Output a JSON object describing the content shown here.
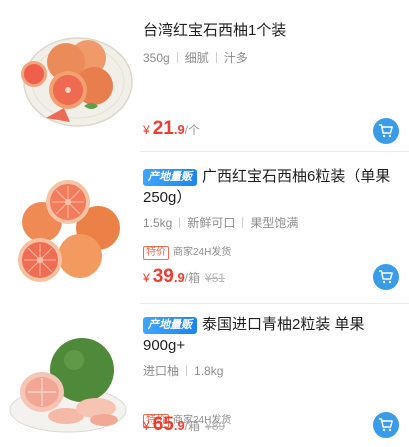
{
  "products": [
    {
      "title": "台湾红宝石西柚1个装",
      "tag": "",
      "attrs": [
        "350g",
        "细腻",
        "汁多"
      ],
      "promo_tag": "",
      "promo_text": "",
      "currency": "¥",
      "price_int": "21",
      "price_dec": ".9",
      "unit": "/个",
      "orig_price": ""
    },
    {
      "title": "广西红宝石西柚6粒装（单果250g）",
      "tag": "产地量贩",
      "attrs": [
        "1.5kg",
        "新鲜可口",
        "果型饱满"
      ],
      "promo_tag": "特价",
      "promo_text": "商家24H发货",
      "currency": "¥",
      "price_int": "39",
      "price_dec": ".9",
      "unit": "/箱",
      "orig_price": "¥51"
    },
    {
      "title": "泰国进口青柚2粒装 单果900g+",
      "tag": "产地量贩",
      "attrs": [
        "进口柚",
        "1.8kg"
      ],
      "promo_tag": "特价",
      "promo_text": "商家24H发货",
      "currency": "¥",
      "price_int": "65",
      "price_dec": ".9",
      "unit": "/箱",
      "orig_price": "¥89"
    }
  ],
  "icons": {
    "cart": "shopping-cart-icon"
  },
  "colors": {
    "price": "#f23b2f",
    "accent": "#3a9be8",
    "tag": "#1c85f0",
    "promo": "#f26b4e"
  }
}
